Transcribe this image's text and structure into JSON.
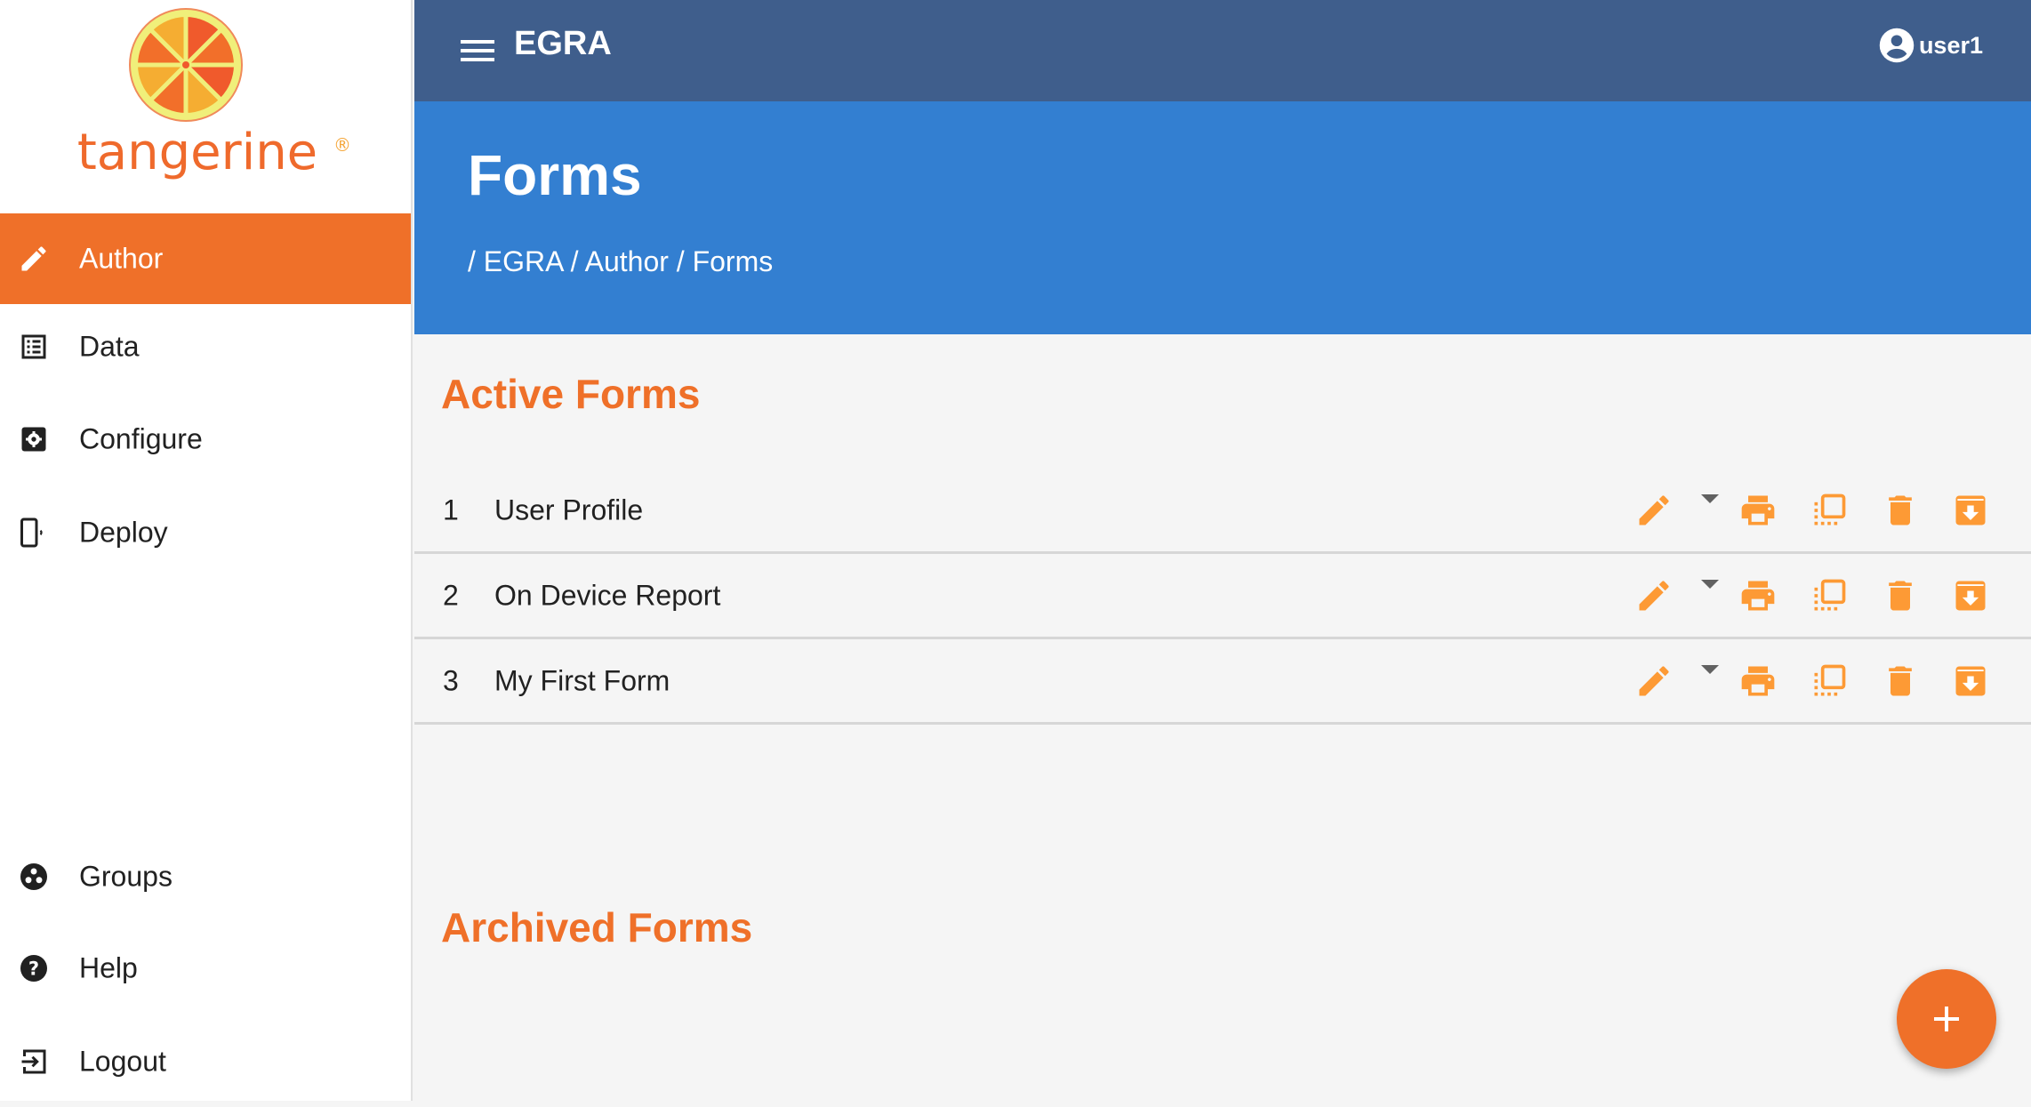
{
  "brand": {
    "name": "tangerine",
    "registered_mark": "®"
  },
  "topbar": {
    "title": "EGRA",
    "user": "user1",
    "menu_icon": "hamburger-menu-icon",
    "user_icon": "account-circle-icon"
  },
  "header": {
    "title": "Forms",
    "breadcrumb": [
      "EGRA",
      "Author",
      "Forms"
    ],
    "separator": "/"
  },
  "sidebar": {
    "items": [
      {
        "label": "Author",
        "icon": "pencil-icon",
        "active": true
      },
      {
        "label": "Data",
        "icon": "list-icon",
        "active": false
      },
      {
        "label": "Configure",
        "icon": "settings-box-icon",
        "active": false
      },
      {
        "label": "Deploy",
        "icon": "mobile-device-icon",
        "active": false
      }
    ],
    "bottom_items": [
      {
        "label": "Groups",
        "icon": "groups-icon"
      },
      {
        "label": "Help",
        "icon": "help-icon"
      },
      {
        "label": "Logout",
        "icon": "logout-icon"
      }
    ]
  },
  "main": {
    "active_title": "Active Forms",
    "archived_title": "Archived Forms",
    "forms": [
      {
        "number": "1",
        "name": "User Profile"
      },
      {
        "number": "2",
        "name": "On Device Report"
      },
      {
        "number": "3",
        "name": "My First Form"
      }
    ],
    "row_actions": [
      "edit-icon",
      "dropdown-caret-icon",
      "print-icon",
      "copy-icon",
      "delete-icon",
      "archive-icon"
    ],
    "fab": "add-form-button"
  },
  "colors": {
    "topbar": "#3f5e8c",
    "header": "#337fd1",
    "accent": "#ef7029",
    "action_icons": "#fd9a35",
    "background": "#f5f5f5"
  }
}
